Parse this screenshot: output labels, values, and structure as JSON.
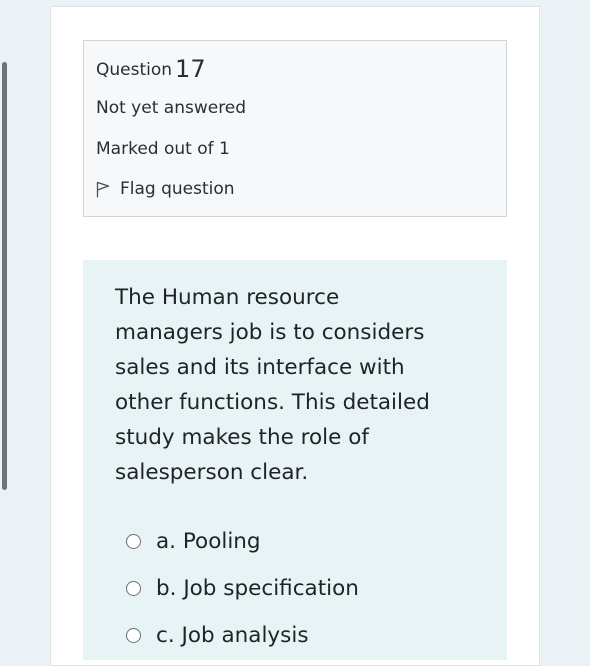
{
  "question_info": {
    "label": "Question",
    "number": "17",
    "status": "Not yet answered",
    "marks": "Marked out of 1",
    "flag_label": "Flag question"
  },
  "question": {
    "text": "The Human resource\nmanagers job is to considers\nsales and its interface with\nother functions. This detailed\nstudy makes the role of\nsalesperson clear."
  },
  "answers": [
    {
      "label": "a. Pooling",
      "selected": false
    },
    {
      "label": "b. Job specification",
      "selected": false
    },
    {
      "label": "c. Job analysis",
      "selected": false
    }
  ],
  "icons": {
    "flag": "flag-outline-icon",
    "radio": "radio-unchecked-icon"
  },
  "colors": {
    "page_background": "#eaf2f5",
    "info_box_background": "#f7f8f9",
    "content_background": "#e7f3f5",
    "text": "#1d2125"
  }
}
